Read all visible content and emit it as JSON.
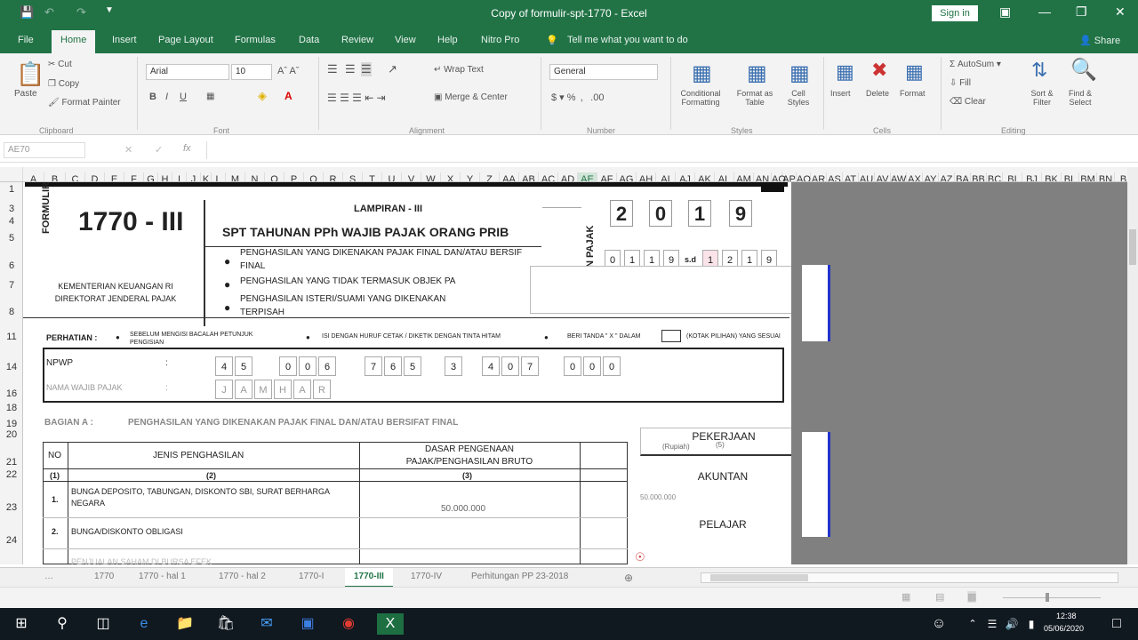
{
  "window": {
    "title": "Copy of formulir-spt-1770  -  Excel",
    "signin": "Sign in"
  },
  "menu": {
    "tabs": [
      "File",
      "Home",
      "Insert",
      "Page Layout",
      "Formulas",
      "Data",
      "Review",
      "View",
      "Help",
      "Nitro Pro"
    ],
    "tell_me": "Tell me what you want to do",
    "share": "Share"
  },
  "ribbon": {
    "cut": "Cut",
    "copy": "Copy",
    "format_painter": "Format Painter",
    "paste": "Paste",
    "font_name": "Arial",
    "font_size": "10",
    "wrap_text": "Wrap Text",
    "merge_center": "Merge & Center",
    "number_format": "General",
    "conditional_formatting": "Conditional Formatting",
    "format_as_table": "Format as Table",
    "cell_styles": "Cell Styles",
    "insert": "Insert",
    "delete": "Delete",
    "format": "Format",
    "autosum": "AutoSum",
    "fill": "Fill",
    "clear": "Clear",
    "sort_filter": "Sort & Filter",
    "find_select": "Find & Select",
    "groups": [
      "Clipboard",
      "Font",
      "Alignment",
      "Number",
      "Styles",
      "Cells",
      "Editing"
    ]
  },
  "formula_bar": {
    "name_box": "AE70",
    "fx": "fx"
  },
  "columns": [
    "A",
    "B",
    "C",
    "D",
    "E",
    "F",
    "G",
    "H",
    "I",
    "J",
    "K",
    "L",
    "M",
    "N",
    "O",
    "P",
    "Q",
    "R",
    "S",
    "T",
    "U",
    "V",
    "W",
    "X",
    "Y",
    "Z",
    "AA",
    "AB",
    "AC",
    "AD",
    "AE",
    "AF",
    "AG",
    "AH",
    "AI",
    "AJ",
    "AK",
    "AL",
    "AM",
    "AN",
    "AO",
    "AP",
    "AQ",
    "AR",
    "AS",
    "AT",
    "AU",
    "AV",
    "AW",
    "AX",
    "AY",
    "AZ",
    "BA",
    "BB",
    "BC",
    "BI",
    "BJ",
    "BK",
    "BL",
    "BM",
    "BN",
    "B"
  ],
  "rows": [
    "1",
    "3",
    "4",
    "5",
    "6",
    "7",
    "8",
    "11",
    "14",
    "16",
    "18",
    "19",
    "20",
    "21",
    "22",
    "23",
    "24"
  ],
  "form": {
    "formulir": "FORMULIR",
    "code": "1770 - III",
    "lampiran": "LAMPIRAN - III",
    "spt_title": "SPT  TAHUNAN PPh WAJIB PAJAK ORANG PRIB",
    "year": [
      "2",
      "0",
      "1",
      "9"
    ],
    "period_start": [
      "0",
      "1",
      "1",
      "9"
    ],
    "sd": "s.d",
    "period_end": [
      "1",
      "2",
      "1",
      "9"
    ],
    "pajak": "N PAJAK",
    "bullets": [
      "PENGHASILAN YANG DIKENAKAN PAJAK FINAL DAN/ATAU BERSIF",
      "FINAL",
      "PENGHASILAN YANG TIDAK TERMASUK OBJEK PA",
      "PENGHASILAN  ISTERI/SUAMI  YANG  DIKENAKAN",
      "TERPISAH"
    ],
    "ministry": "KEMENTERIAN KEUANGAN RI",
    "directorate": "DIREKTORAT JENDERAL PAJAK",
    "perhatian": "PERHATIAN :",
    "note1": "SEBELUM MENGISI BACALAH PETUNJUK",
    "note1b": "PENGISIAN",
    "note2": "ISI DENGAN HURUF CETAK / DIKETIK DENGAN TINTA HITAM",
    "note3": "BERI TANDA \" X \" DALAM",
    "note4": "(KOTAK PILIHAN) YANG SESUAI",
    "npwp_label": "NPWP",
    "colon": ":",
    "npwp_digits": [
      "4",
      "5",
      "0",
      "0",
      "6",
      "7",
      "6",
      "5",
      "3",
      "4",
      "0",
      "7",
      "0",
      "0",
      "0"
    ],
    "nama_label": "NAMA WAJIB PAJAK",
    "nama_chars": [
      "J",
      "A",
      "M",
      "H",
      "A",
      "R"
    ],
    "bagian": "BAGIAN A :",
    "bagian_title": "PENGHASILAN YANG  DIKENAKAN PAJAK FINAL DAN/ATAU BERSIFAT FINAL",
    "col_no": "NO",
    "col_jenis": "JENIS PENGHASILAN",
    "col_dasar1": "DASAR PENGENAAN",
    "col_dasar2": "PAJAK/PENGHASILAN BRUTO",
    "idx": [
      "(1)",
      "(2)",
      "(3)"
    ],
    "row1_no": "1.",
    "row1_text1": "BUNGA DEPOSITO, TABUNGAN, DISKONTO SBI, SURAT BERHARGA",
    "row1_text2": "NEGARA",
    "row1_value": "50.000.000",
    "row2_no": "2.",
    "row2_text": "BUNGA/DISKONTO OBLIGASI",
    "row3_text": "PENJUALAN SAHAM DI BURSA EFEK",
    "rupiah": "(Rupiah)",
    "col5": "(5)",
    "dropdown": [
      "PEKERJAAN",
      "AKUNTAN",
      "PELAJAR"
    ]
  },
  "sheets": [
    "1770",
    "1770 - hal 1",
    "1770 - hal 2",
    "1770-I",
    "1770-III",
    "1770-IV",
    "Perhitungan PP 23-2018"
  ],
  "active_sheet": "1770-III",
  "taskbar": {
    "time": "12:38",
    "date": "05/06/2020"
  }
}
